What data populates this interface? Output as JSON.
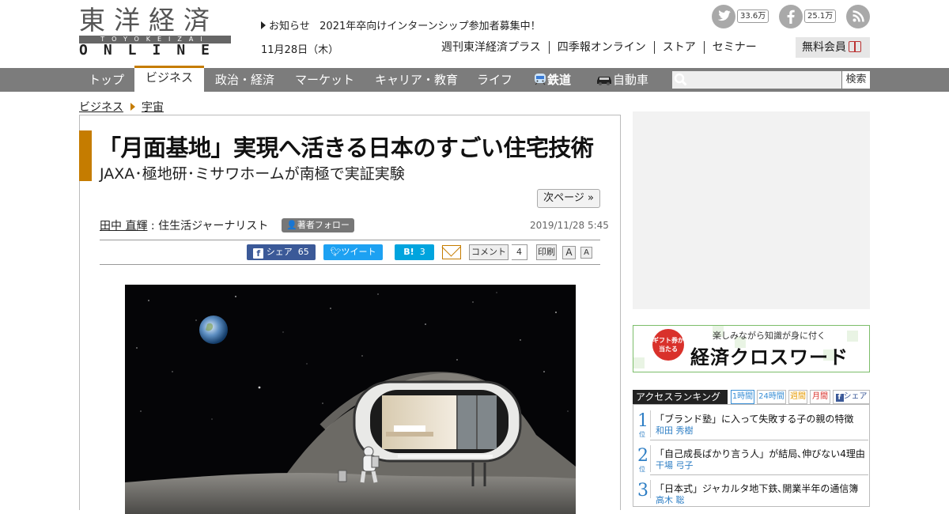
{
  "header": {
    "logo_jp": "東洋経済",
    "logo_en_small": "TOYOKEIZAI",
    "logo_online": "ONLINE",
    "notice_label": "お知らせ",
    "notice_text": "2021年卒向けインターンシップ参加者募集中！",
    "date": "11月28日（木）",
    "links": [
      "週刊東洋経済プラス",
      "四季報オンライン",
      "ストア",
      "セミナー"
    ],
    "signup_label": "無料会員",
    "social": {
      "twitter_count": "33.6万",
      "facebook_count": "25.1万"
    }
  },
  "nav": {
    "items": [
      "トップ",
      "ビジネス",
      "政治・経済",
      "マーケット",
      "キャリア・教育",
      "ライフ",
      "鉄道",
      "自動車"
    ],
    "active": "ビジネス",
    "search_button": "検索"
  },
  "breadcrumb": [
    "ビジネス",
    "宇宙"
  ],
  "article": {
    "title": "「月面基地」実現へ活きる日本のすごい住宅技術",
    "subtitle": "JAXA･極地研･ミサワホームが南極で実証実験",
    "next_page": "次ページ »",
    "author_name": "田中 直輝",
    "author_role": " : 住生活ジャーナリスト",
    "follow_label": "著者フォロー",
    "published": "2019/11/28 5:45",
    "share": {
      "facebook_label": "シェア",
      "facebook_count": "65",
      "tweet_label": "ツイート",
      "hatena_label": "B!",
      "hatena_count": "3",
      "comment_label": "コメント",
      "comment_count": "4",
      "print_label": "印刷",
      "font_large": "A",
      "font_small": "A"
    }
  },
  "sidebar": {
    "banner": {
      "badge": "ギフト券が当たる",
      "tagline": "楽しみながら知識が身に付く",
      "title": "経済クロスワード"
    },
    "ranking": {
      "heading": "アクセスランキング",
      "tabs": [
        "1時間",
        "24時間",
        "週間",
        "月間",
        "シェア"
      ],
      "active_tab": "1時間",
      "rank_suffix": "位",
      "items": [
        {
          "rank": "1",
          "title": "「ブランド塾」に入って失敗する子の親の特徴",
          "author": "和田 秀樹"
        },
        {
          "rank": "2",
          "title": "「自己成長ばかり言う人」が結局､伸びない4理由",
          "author": "干場 弓子"
        },
        {
          "rank": "3",
          "title": "「日本式」ジャカルタ地下鉄､開業半年の通信簿",
          "author": "高木 聡"
        }
      ]
    }
  },
  "colors": {
    "accent": "#c57c00",
    "nav_bg": "#7c7c7c",
    "facebook": "#3b5998",
    "twitter": "#1da1f2",
    "hatena": "#00a4de",
    "ranking_blue": "#2f7fc5"
  }
}
